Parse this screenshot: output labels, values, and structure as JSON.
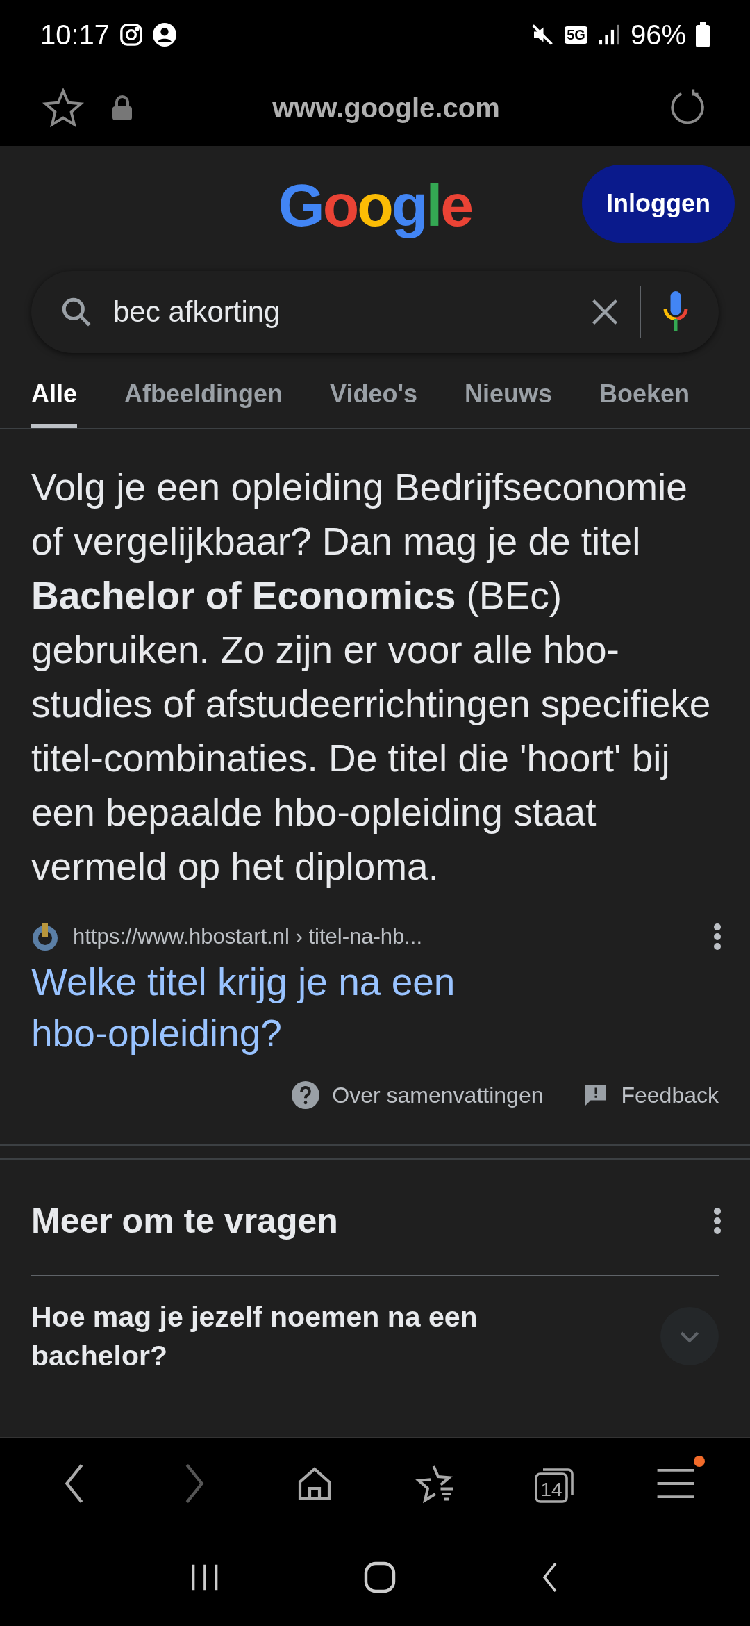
{
  "status_bar": {
    "time": "10:17",
    "network": "5G",
    "battery": "96%"
  },
  "browser": {
    "url": "www.google.com"
  },
  "header": {
    "logo": "Google",
    "sign_in": "Inloggen"
  },
  "search": {
    "value": "bec afkorting"
  },
  "tabs": [
    {
      "label": "Alle",
      "selected": true
    },
    {
      "label": "Afbeeldingen",
      "selected": false
    },
    {
      "label": "Video's",
      "selected": false
    },
    {
      "label": "Nieuws",
      "selected": false
    },
    {
      "label": "Boeken",
      "selected": false
    }
  ],
  "snippet": {
    "text": "Volg je een opleiding Bedrijfseconomie of vergelijkbaar? Dan mag je de titel **Bachelor of Economics** (BEc) gebruiken. Zo zijn er voor alle hbo-studies of afstudeerrichtingen specifieke titel-combinaties. De titel die 'hoort' bij een bepaalde hbo-opleiding staat vermeld op het diploma.",
    "source": "https://www.hbostart.nl › titel-na-hb...",
    "title": "Welke titel krijg je na een hbo-opleiding?",
    "about": "Over samenvattingen",
    "feedback": "Feedback"
  },
  "related": {
    "title": "Meer om te vragen",
    "questions": [
      {
        "text": "Hoe mag je jezelf noemen na een bachelor?",
        "expanded": false
      }
    ]
  },
  "toolbar": {
    "tab_count": "14",
    "menu_badge": true
  }
}
